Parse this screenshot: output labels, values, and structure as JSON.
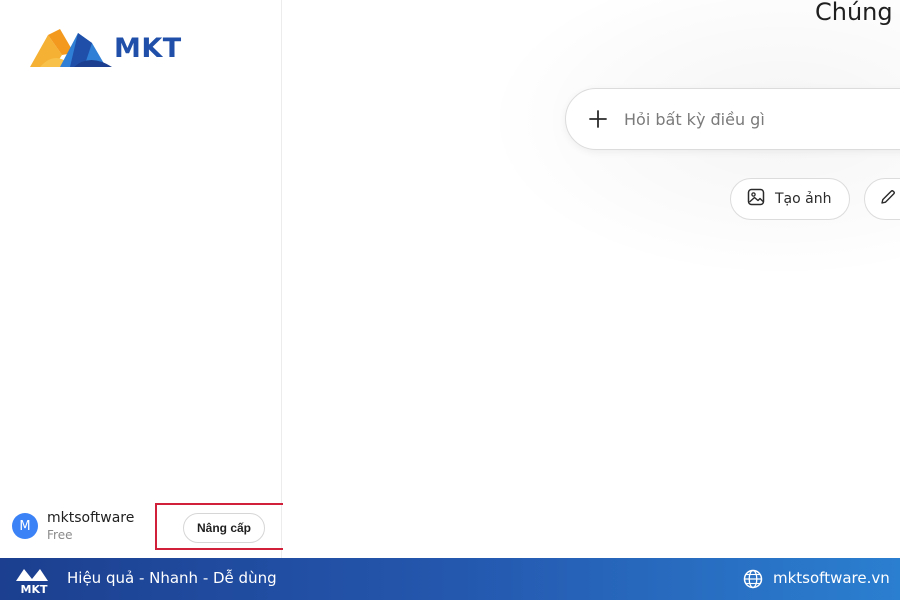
{
  "brand": {
    "logo_text": "MKT",
    "logo_colors": {
      "orange": "#f5a623",
      "blue": "#1f4fa8",
      "light_blue": "#2f7fd6"
    }
  },
  "sidebar": {
    "user": {
      "avatar_letter": "M",
      "name": "mktsoftware",
      "plan": "Free"
    },
    "upgrade_label": "Nâng cấp"
  },
  "main": {
    "heading": "Chúng",
    "composer": {
      "plus_icon": "plus-icon",
      "placeholder": "Hỏi bất kỳ điều gì"
    },
    "chips": [
      {
        "icon": "image-icon",
        "label": "Tạo ảnh"
      },
      {
        "icon": "pencil-icon",
        "label": ""
      }
    ]
  },
  "footer": {
    "tagline": "Hiệu quả - Nhanh - Dễ dùng",
    "website": "mktsoftware.vn",
    "logo_text": "MKT",
    "colors": {
      "start": "#1c3f8f",
      "end": "#2b7fd0",
      "highlight": "#d0203a"
    }
  }
}
